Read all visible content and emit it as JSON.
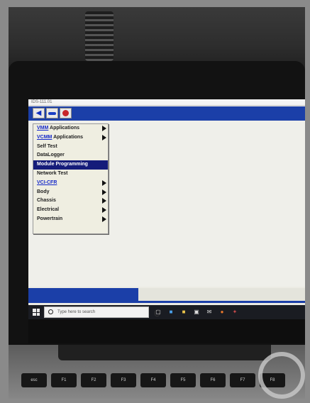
{
  "window": {
    "title": "IDS-111.01"
  },
  "toolbar": {
    "buttons": [
      "back-arrow-icon",
      "vehicle-icon",
      "ladybug-icon"
    ]
  },
  "menu": {
    "items": [
      {
        "label": "VMM Applications",
        "link_part": "VMM",
        "rest": " Applications",
        "submenu": true,
        "selected": false
      },
      {
        "label": "VCMM Applications",
        "link_part": "VCMM",
        "rest": " Applications",
        "submenu": true,
        "selected": false
      },
      {
        "label": "Self Test",
        "submenu": false,
        "selected": false
      },
      {
        "label": "DataLogger",
        "submenu": false,
        "selected": false
      },
      {
        "label": "Module Programming",
        "submenu": false,
        "selected": true
      },
      {
        "label": "Network Test",
        "submenu": false,
        "selected": false
      },
      {
        "label": "VCI-CFR",
        "link_part": "VCI-CFR",
        "rest": "",
        "submenu": true,
        "selected": false
      },
      {
        "label": "Body",
        "submenu": true,
        "selected": false
      },
      {
        "label": "Chassis",
        "submenu": true,
        "selected": false
      },
      {
        "label": "Electrical",
        "submenu": true,
        "selected": false
      },
      {
        "label": "Powertrain",
        "submenu": true,
        "selected": false
      }
    ]
  },
  "taskbar": {
    "search_placeholder": "Type here to search"
  },
  "keyboard": {
    "keys": [
      "esc",
      "F1",
      "F2",
      "F3",
      "F4",
      "F5",
      "F6",
      "F7",
      "F8"
    ]
  },
  "colors": {
    "toolbar_blue": "#1b3fa8",
    "menu_selected": "#151c7a",
    "link_blue": "#1327c9"
  }
}
